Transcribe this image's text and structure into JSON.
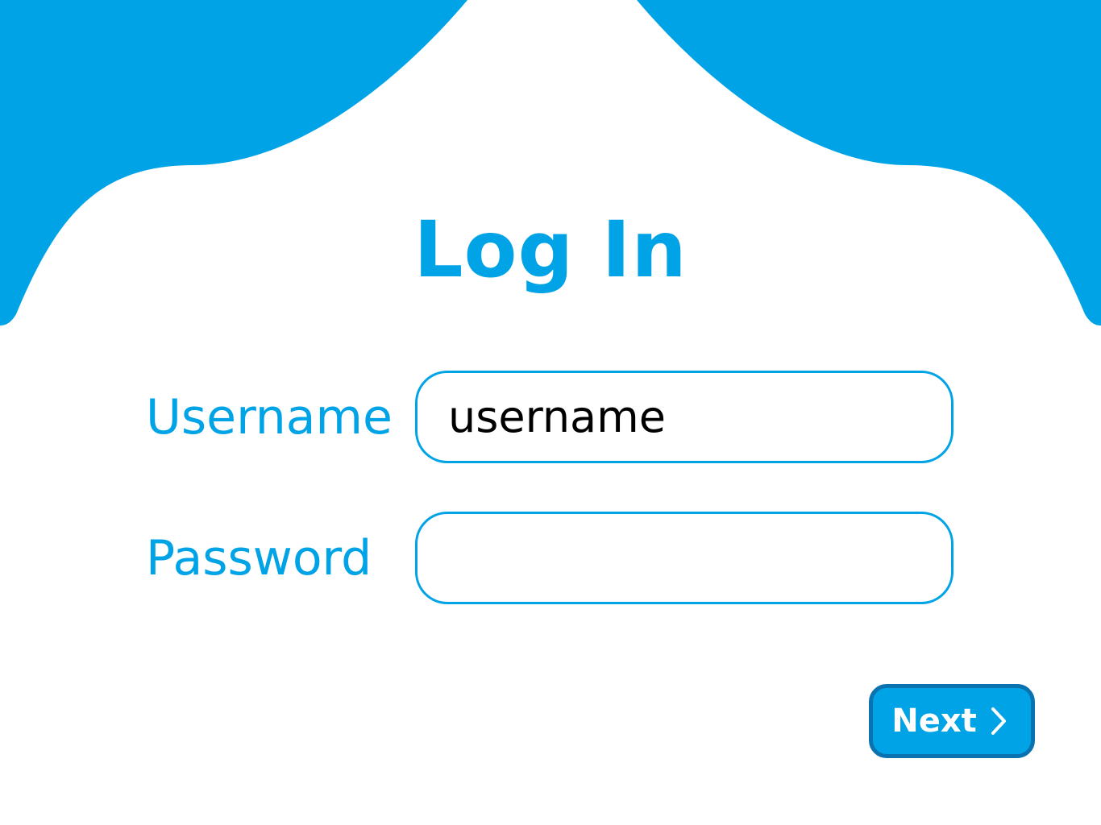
{
  "theme": {
    "accent": "#00a3e6",
    "button_border": "#0b72b0",
    "field_text": "#000000",
    "background": "#ffffff"
  },
  "login": {
    "title": "Log In",
    "username_label": "Username",
    "username_value": "username",
    "password_label": "Password",
    "password_value": "",
    "next_label": "Next",
    "next_icon": "chevron-right-icon"
  }
}
